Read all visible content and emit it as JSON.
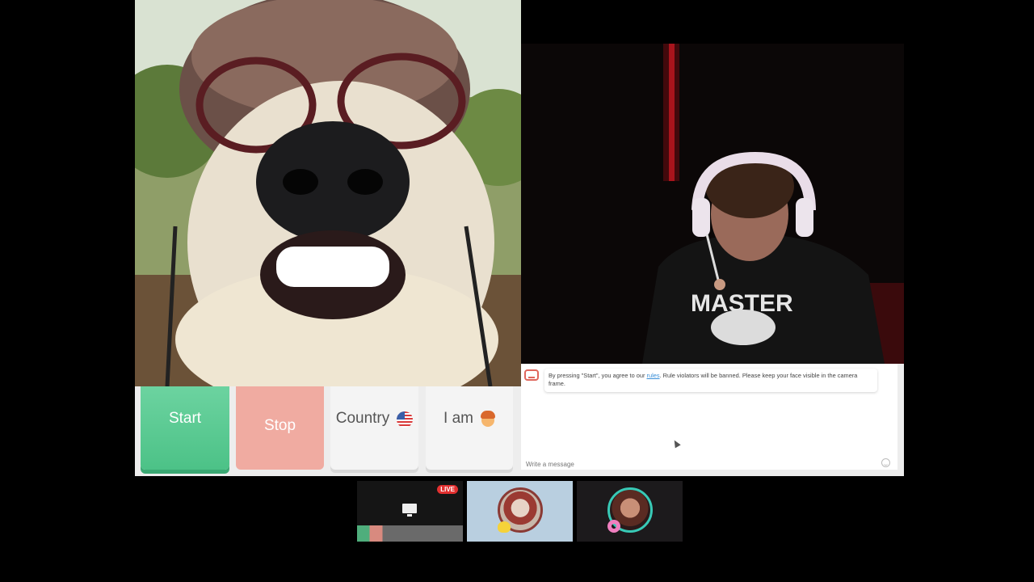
{
  "controls": {
    "start_label": "Start",
    "stop_label": "Stop",
    "country_label": "Country",
    "country_icon": "us-flag-icon",
    "iam_label": "I am",
    "iam_icon": "boy-face-icon"
  },
  "chat": {
    "system_message_prefix": "By pressing \"Start\", you agree to our ",
    "system_message_link": "rules",
    "system_message_suffix": ". Rule violators will be banned. Please keep your face visible in the camera frame.",
    "input_placeholder": "Write a message"
  },
  "thumbnails": [
    {
      "badge": "LIVE"
    }
  ],
  "colors": {
    "start": "#4cc287",
    "stop": "#f0aba1",
    "accent_red": "#e0675d",
    "live_red": "#e23030"
  }
}
